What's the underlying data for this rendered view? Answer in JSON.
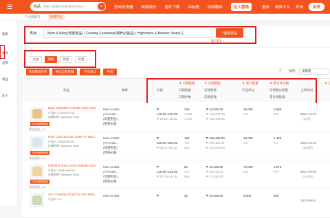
{
  "topbar": {
    "search_category": "商品",
    "search_placeholder": "请输入关键词/店铺名称/商品ID",
    "nav": [
      "常用到快捷",
      "商家成长",
      "插件下载",
      "AI标题",
      "四部翻译"
    ],
    "pill": "达人营销",
    "right": [
      "退出",
      "简体中文",
      "导出"
    ],
    "user": "会员"
  },
  "tabs": {
    "items": [
      "行业搜索页",
      "热销产品"
    ]
  },
  "sidebar": {
    "items": [
      "搜索",
      "类目",
      "品牌",
      "商品",
      "达人"
    ]
  },
  "category": {
    "label": "类目:",
    "value": "Mom & Baby(母婴用品) / Feeding Essentials(喂养必备品) / Highchairs & Booster Seats(儿",
    "search_btn": "查看商品",
    "more": "展示更多 >"
  },
  "type_tabs": [
    "大盘",
    "周期",
    "月度",
    "年度"
  ],
  "actions": [
    "商品数据分析",
    "导出全部店铺",
    "产品对比",
    "导出"
  ],
  "sort": {
    "label": "排序:",
    "value": "按销量"
  },
  "columns": {
    "product": "商品",
    "category": "类目",
    "price": "价格",
    "daily_sales": "日销售额",
    "daily_sales2": "日销售额",
    "daily_units": "日销件数",
    "total_sales": "累计销量",
    "total_rev": "产品评分",
    "cum_rev": "累计评论数",
    "cum_rev2": "日销售价额量",
    "cum_rev3": "累计销售额",
    "listed": "上架时间",
    "rank": "上"
  },
  "rows": [
    {
      "name": "Baby Inflatable Portable Baby Sofa...",
      "id": "产品ID: 27015979711",
      "shop": "店铺名称: Babywoo Store",
      "stat": "商品星级: 4.8",
      "tag": "TikTok推荐商品",
      "category": [
        "Mom & Bab",
        "y>Feedin...",
        "(母婴用品)",
        "(喂养必备"
      ],
      "price": [
        "₱",
        "128.00~128.00",
        "₱ 16.20~16.26"
      ],
      "sales": [
        "340",
        "1,095",
        "1,240"
      ],
      "revenue": [
        "₱ 43,520.00",
        "₱ 140,672.00",
        "₱ 159,104.00"
      ],
      "total": [
        "10,000",
        "4.9"
      ],
      "reviews": [
        "1,996",
        "₱ 0"
      ],
      "date": "2024-10-29",
      "days": "(10天)",
      "thumb_color": "#e8c48a"
    },
    {
      "name": "High Chair Booster Seat For Baby...",
      "id": "产品ID: 25415591261",
      "shop": "店铺名称: Babywoo Store",
      "stat": "商品星级: 4.8",
      "tag": "TikTok推荐商品",
      "category": [
        "Mom & Bab",
        "y>Feedin...",
        "(母婴用品)",
        "(喂养必备"
      ],
      "price": [
        "₱",
        "545.00~545.00",
        "₱ 69.22~69.22"
      ],
      "sales": [
        "199",
        "747",
        "802"
      ],
      "revenue": [
        "₱ 108,455.00",
        "₱ 407,115.00",
        "₱ 437,090.00"
      ],
      "total": [
        "10,000",
        "4.8"
      ],
      "reviews": [
        "1,455",
        "₱ 0"
      ],
      "date": "2024-10-24",
      "days": "(264天)",
      "thumb_color": "#d9e6f5"
    },
    {
      "name": "Inflatable Baby Sofa Inflatable Bab...",
      "id": "产品ID: 25381496395",
      "shop": "店铺名称: Babywoo Store",
      "stat": "商品星级: 4.8",
      "tag": "TikTok推荐商品",
      "category": [
        "Mom & Bab",
        "y>Feedin...",
        "(母婴用品)",
        "(喂养必备"
      ],
      "price": [
        "₱",
        "128.00~128.00",
        "₱ 16.20~16.26"
      ],
      "sales": [
        "82",
        "370",
        "565"
      ],
      "revenue": [
        "₱ 10,496.00",
        "₱ 46,512.00",
        "₱ 72,320.00"
      ],
      "total": [
        "72,000",
        "4.8"
      ],
      "reviews": [
        "1,575",
        "₱ 0"
      ],
      "date": "2024-09-06",
      "days": "(411天)",
      "thumb_color": "#f2d39b"
    },
    {
      "name": "2in1 Camping Chair for Kids Baby...",
      "id": "产品ID: 22 ...",
      "shop": "",
      "stat": "",
      "tag": "",
      "category": [
        "Mom & Bab"
      ],
      "price": [
        "₱"
      ],
      "sales": [
        "32"
      ],
      "revenue": [
        "₱ 10,496.00"
      ],
      "total": [
        "6,000"
      ],
      "reviews": [
        "600"
      ],
      "date": "2024-09-01",
      "days": "",
      "thumb_color": "#c9dcb5"
    }
  ]
}
